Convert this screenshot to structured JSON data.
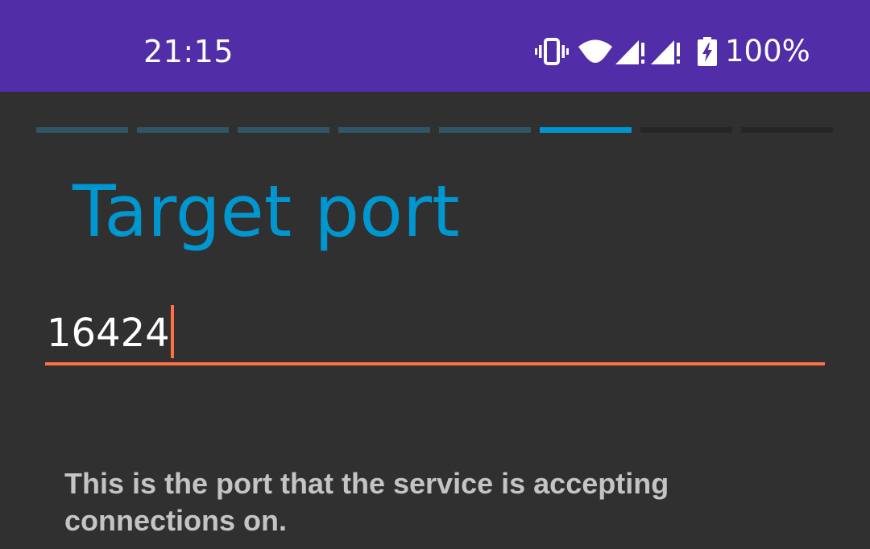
{
  "status_bar": {
    "time": "21:15",
    "battery_text": "100%",
    "background_color": "#512DA8",
    "icons": [
      "vibrate-icon",
      "wifi-icon",
      "signal-icon",
      "signal-icon",
      "battery-charging-icon"
    ]
  },
  "wizard": {
    "total_steps": 8,
    "current_step": 6,
    "colors": {
      "completed": "#2f5566",
      "current": "#0095d0",
      "upcoming": "#262626"
    }
  },
  "page": {
    "title": "Target port",
    "title_color": "#0096d0",
    "port_field": {
      "value": "16424",
      "accent_color": "#ff7043"
    },
    "help_text": "This is the port that the service is accepting connections on."
  }
}
